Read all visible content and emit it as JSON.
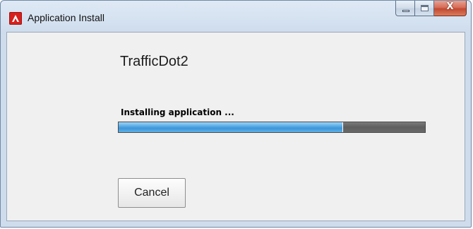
{
  "window": {
    "title": "Application Install",
    "icon": "adobe-air-icon",
    "caption_buttons": [
      "minimize-icon",
      "maximize-icon",
      "close-icon"
    ],
    "close_glyph": "X"
  },
  "installer": {
    "app_name": "TrafficDot2",
    "status": "Installing application ...",
    "progress_fraction": 0.73,
    "cancel_label": "Cancel"
  },
  "colors": {
    "progress_fill": "#4aa3e3",
    "progress_track": "#6a6a6a",
    "close_button": "#c8513a",
    "app_icon": "#d8201c"
  }
}
